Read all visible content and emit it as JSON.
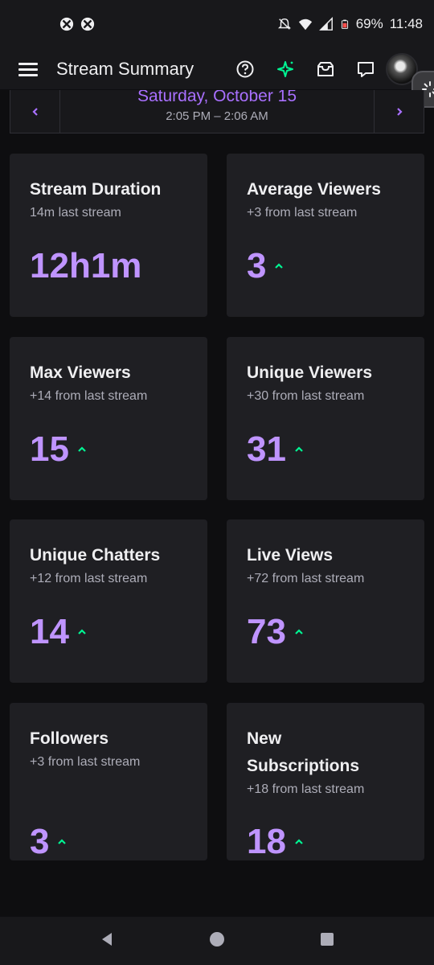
{
  "status_bar": {
    "battery": "69%",
    "time": "11:48"
  },
  "header": {
    "title": "Stream Summary"
  },
  "date_nav": {
    "date": "Saturday, October 15",
    "time_range": "2:05 PM – 2:06 AM"
  },
  "cards": [
    {
      "title": "Stream Duration",
      "sub": "14m last stream",
      "value": "12h1m",
      "trend_up": false
    },
    {
      "title": "Average Viewers",
      "sub": "+3 from last stream",
      "value": "3",
      "trend_up": true
    },
    {
      "title": "Max Viewers",
      "sub": "+14 from last stream",
      "value": "15",
      "trend_up": true
    },
    {
      "title": "Unique Viewers",
      "sub": "+30 from last stream",
      "value": "31",
      "trend_up": true
    },
    {
      "title": "Unique Chatters",
      "sub": "+12 from last stream",
      "value": "14",
      "trend_up": true
    },
    {
      "title": "Live Views",
      "sub": "+72 from last stream",
      "value": "73",
      "trend_up": true
    },
    {
      "title": "Followers",
      "sub": "+3 from last stream",
      "value": "3",
      "trend_up": true
    },
    {
      "title": "New Subscriptions",
      "sub": "+18 from last stream",
      "value": "18",
      "trend_up": true
    }
  ],
  "colors": {
    "accent": "#bf94ff",
    "trend_up": "#00f593",
    "card_bg": "#1f1f23",
    "page_bg": "#0e0e10"
  }
}
